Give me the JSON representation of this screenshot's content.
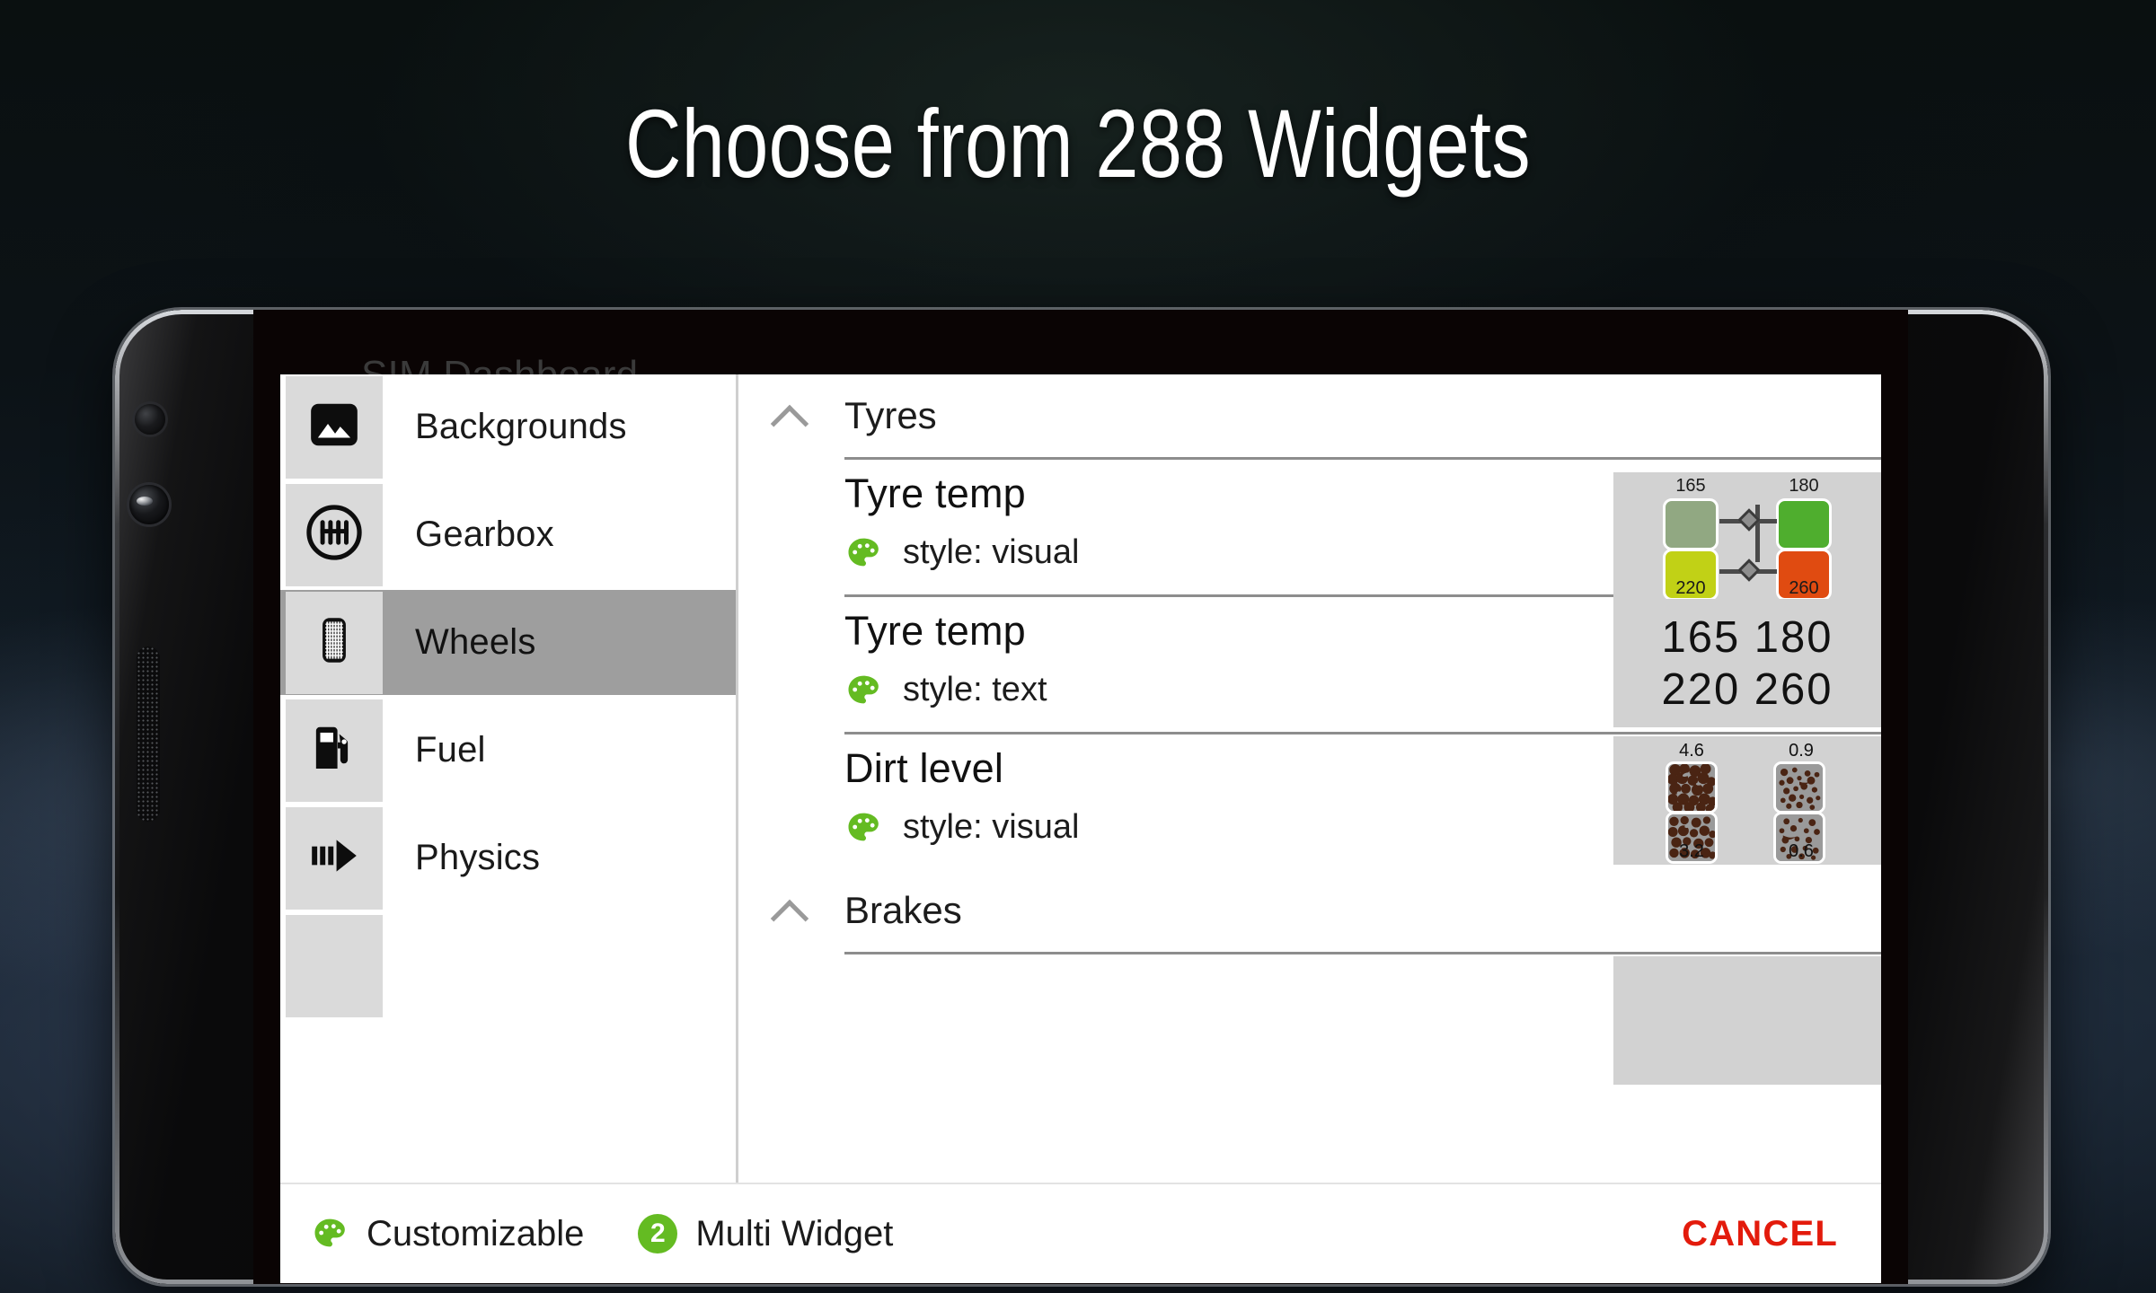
{
  "hero": {
    "title": "Choose from 288 Widgets"
  },
  "app": {
    "title_behind": "SIM Dashboard"
  },
  "sidebar": {
    "items": [
      {
        "label": "Backgrounds",
        "icon": "image-icon",
        "selected": false
      },
      {
        "label": "Gearbox",
        "icon": "gearbox-icon",
        "selected": false
      },
      {
        "label": "Wheels",
        "icon": "tyre-icon",
        "selected": true
      },
      {
        "label": "Fuel",
        "icon": "fuel-pump-icon",
        "selected": false
      },
      {
        "label": "Physics",
        "icon": "physics-motion-icon",
        "selected": false
      }
    ]
  },
  "content": {
    "groups": [
      {
        "title": "Tyres",
        "expanded": true,
        "widgets": [
          {
            "name": "Tyre temp",
            "style_label": "style: visual",
            "preview_type": "tyre-temp-visual",
            "preview": {
              "values": [
                "165",
                "180",
                "220",
                "260"
              ],
              "colors": [
                "#91a882",
                "#4fae2e",
                "#c1d116",
                "#e04b11"
              ]
            }
          },
          {
            "name": "Tyre temp",
            "style_label": "style: text",
            "preview_type": "tyre-temp-text",
            "preview": {
              "line1": "165 180",
              "line2": "220 260"
            }
          },
          {
            "name": "Dirt level",
            "style_label": "style: visual",
            "preview_type": "dirt-visual",
            "preview": {
              "values": [
                "4.6",
                "0.9",
                "3.2",
                "0.6"
              ],
              "dirt_color": "#4a2413"
            }
          }
        ]
      },
      {
        "title": "Brakes",
        "expanded": true,
        "widgets": []
      }
    ]
  },
  "footer": {
    "customizable_label": "Customizable",
    "multi_widget_badge": "2",
    "multi_widget_label": "Multi Widget",
    "cancel_label": "CANCEL"
  },
  "colors": {
    "accent_green": "#64bb22",
    "cancel_red": "#e31b0c",
    "selected_row": "#9e9e9e",
    "icon_tile": "#dadada",
    "preview_bg": "#d2d2d2"
  }
}
